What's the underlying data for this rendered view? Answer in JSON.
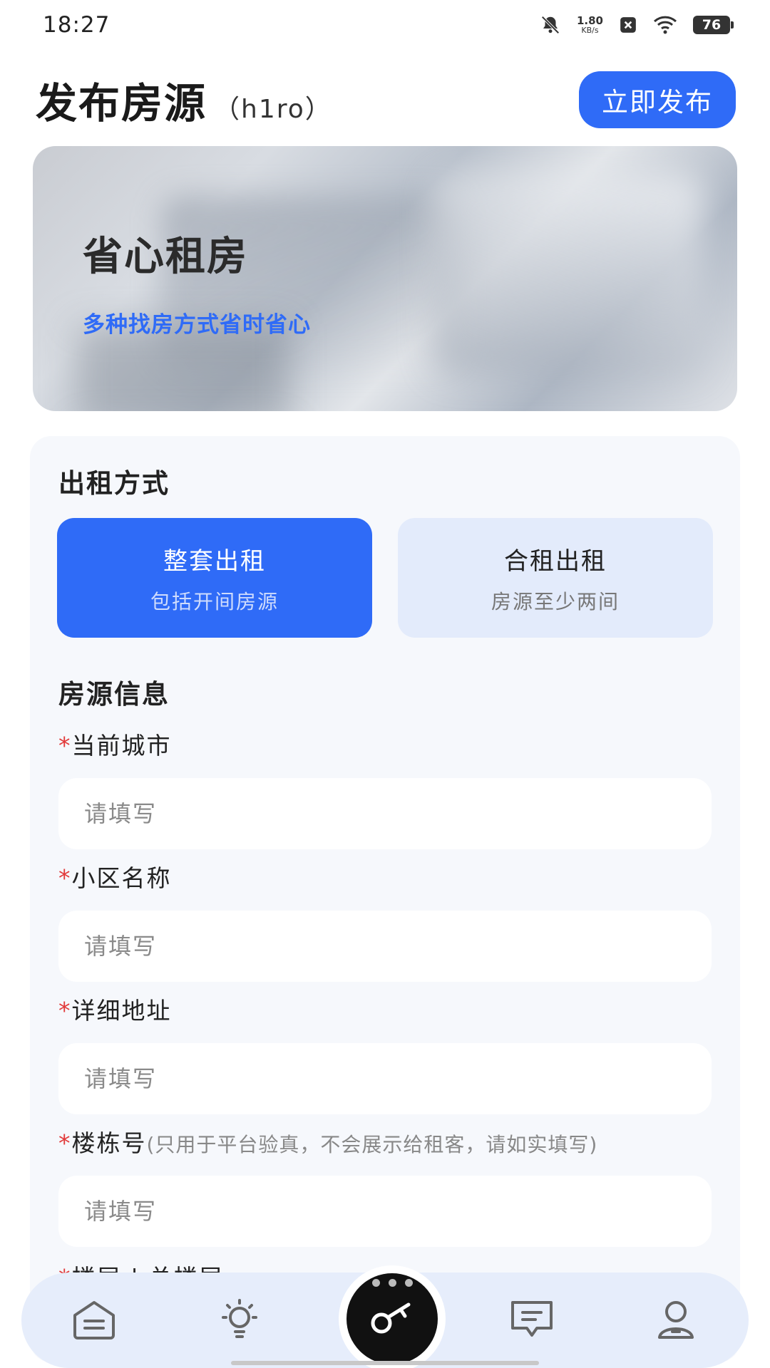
{
  "status_bar": {
    "time": "18:27",
    "net_speed_value": "1.80",
    "net_speed_unit": "KB/s",
    "battery": "76",
    "icons": [
      "mute-bell-icon",
      "sim-off-icon",
      "wifi-icon",
      "battery-icon"
    ]
  },
  "header": {
    "title": "发布房源",
    "subtitle": "（h1ro）",
    "publish_button": "立即发布"
  },
  "banner": {
    "title": "省心租房",
    "subtitle": "多种找房方式省时省心"
  },
  "rent_mode": {
    "section_title": "出租方式",
    "options": [
      {
        "label": "整套出租",
        "desc": "包括开间房源",
        "selected": true
      },
      {
        "label": "合租出租",
        "desc": "房源至少两间",
        "selected": false
      }
    ]
  },
  "listing_info": {
    "section_title": "房源信息",
    "required_mark": "*",
    "fields": [
      {
        "label": "当前城市",
        "hint": "",
        "placeholder": "请填写",
        "value": ""
      },
      {
        "label": "小区名称",
        "hint": "",
        "placeholder": "请填写",
        "value": ""
      },
      {
        "label": "详细地址",
        "hint": "",
        "placeholder": "请填写",
        "value": ""
      },
      {
        "label": "楼栋号",
        "hint": "(只用于平台验真，不会展示给租客，请如实填写)",
        "placeholder": "请填写",
        "value": ""
      }
    ],
    "clipped_label": "楼层 | 总楼层"
  },
  "bottom_nav": {
    "items": [
      "home-icon",
      "bulb-icon",
      "key-icon",
      "message-icon",
      "profile-icon"
    ],
    "active": "key-icon"
  },
  "colors": {
    "accent": "#2f6bf7",
    "required": "#e23a3a",
    "card_bg": "#f6f8fc",
    "option_unselected": "#e3ebfb",
    "nav_bg": "#e6edfb"
  }
}
